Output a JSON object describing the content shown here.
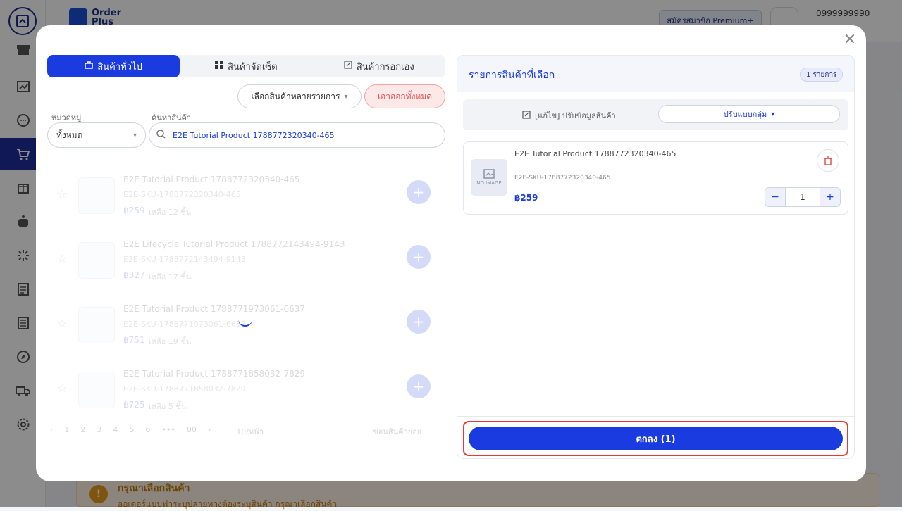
{
  "background": {
    "brand": {
      "line1": "Order",
      "line2": "Plus"
    },
    "premium_label": "สมัครสมาชิก Premium+",
    "phone": "0999999990",
    "warning": {
      "title": "กรุณาเลือกสินค้า",
      "desc": "ออเดอร์แบบฟ่าระบุปลายทางต้องระบุสินค้า กรุณาเลือกสินค้า"
    }
  },
  "modal": {
    "tabs": [
      {
        "label": "สินค้าทั่วไป",
        "icon": "bag-icon",
        "active": true
      },
      {
        "label": "สินค้าจัดเซ็ต",
        "icon": "grid-icon",
        "active": false
      },
      {
        "label": "สินค้ากรอกเอง",
        "icon": "edit-icon",
        "active": false
      }
    ],
    "select_multi_label": "เลือกสินค้าหลายรายการ",
    "clear_all_label": "เอาออกทั้งหมด",
    "category_label": "หมวดหมู่",
    "category_value": "ทั้งหมด",
    "search_label": "ค้นหาสินค้า",
    "search_value": "E2E Tutorial Product 1788772320340-465",
    "products": [
      {
        "name": "E2E Tutorial Product 1788772320340-465",
        "sku": "E2E-SKU-1788772320340-465",
        "price": "฿259",
        "stock": "เหลือ 12 ชิ้น"
      },
      {
        "name": "E2E Lifecycle Tutorial Product 1788772143494-9143",
        "sku": "E2E-SKU-1788772143494-9143",
        "price": "฿327",
        "stock": "เหลือ 17 ชิ้น"
      },
      {
        "name": "E2E Tutorial Product 1788771973061-6637",
        "sku": "E2E-SKU-1788771973061-6637",
        "price": "฿751",
        "stock": "เหลือ 19 ชิ้น"
      },
      {
        "name": "E2E Tutorial Product 1788771858032-7829",
        "sku": "E2E-SKU-1788771858032-7829",
        "price": "฿725",
        "stock": "เหลือ 5 ชิ้น"
      }
    ],
    "pagination": {
      "pages": [
        "1",
        "2",
        "3",
        "4",
        "5",
        "6",
        "•••",
        "80"
      ],
      "per_page": "10/หน้า",
      "hide_label": "ซ่อนสินค้าย่อย"
    },
    "selected": {
      "title": "รายการสินค้าที่เลือก",
      "count": "1 รายการ",
      "edit_label": "[แก้ไข] ปรับข้อมูลสินค้า",
      "bulk_label": "ปรับแบบกลุ่ม",
      "item": {
        "name": "E2E Tutorial Product 1788772320340-465",
        "sku": "E2E-SKU-1788772320340-465",
        "price": "฿259",
        "qty": "1",
        "no_image": "NO IMAGE"
      },
      "confirm_label": "ตกลง (1)"
    }
  },
  "colors": {
    "accent": "#1a3be0",
    "danger": "#e53935",
    "sidebar_active": "#1e2f9c"
  }
}
